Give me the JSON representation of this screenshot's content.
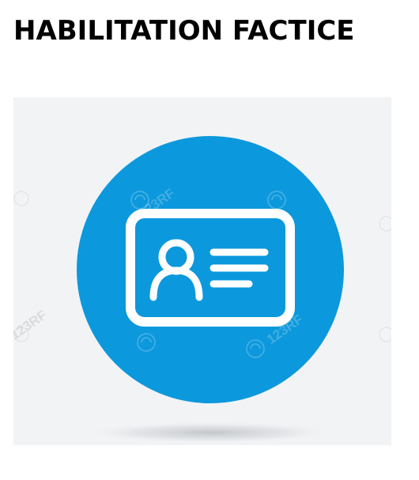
{
  "title": "HABILITATION FACTICE",
  "icon": {
    "name": "id-card-icon",
    "circle_color": "#0c98dc",
    "glyph_color": "#ffffff",
    "background_color": "#f2f3f5"
  },
  "watermark": {
    "text": "123RF"
  }
}
